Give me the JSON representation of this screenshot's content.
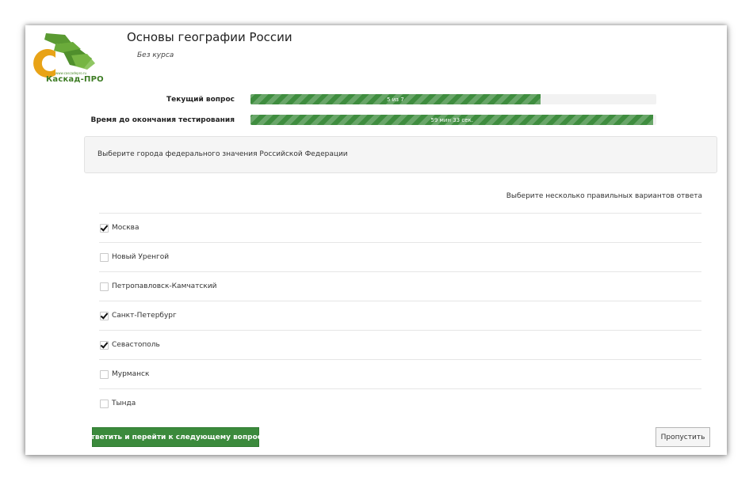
{
  "logo": {
    "url_text": "www.cascadepro.ru",
    "name": "Каскад-ПРО",
    "colors": {
      "green": "#5a9a32",
      "orange": "#e8a317"
    }
  },
  "header": {
    "title": "Основы географии России",
    "subtitle": "Без курса"
  },
  "progress": {
    "current_question": {
      "label": "Текущий вопрос",
      "text": "5 из 7",
      "current": 5,
      "total": 7
    },
    "time_remaining": {
      "label": "Время до окончания тестирования",
      "text": "59 мин 33 сек.",
      "fraction": 0.993
    },
    "bar_color": "#3f8d3f"
  },
  "question": {
    "text": "Выберите города федерального значения Российской Федерации"
  },
  "instruction": "Выберите несколько правильных вариантов ответа",
  "options": [
    {
      "label": "Москва",
      "checked": true
    },
    {
      "label": "Новый Уренгой",
      "checked": false
    },
    {
      "label": "Петропавловск-Камчатский",
      "checked": false
    },
    {
      "label": "Санкт-Петербург",
      "checked": true
    },
    {
      "label": "Севастополь",
      "checked": true
    },
    {
      "label": "Мурманск",
      "checked": false
    },
    {
      "label": "Тында",
      "checked": false
    }
  ],
  "actions": {
    "submit_label": "Ответить и перейти к следующему вопросу",
    "skip_label": "Пропустить"
  }
}
